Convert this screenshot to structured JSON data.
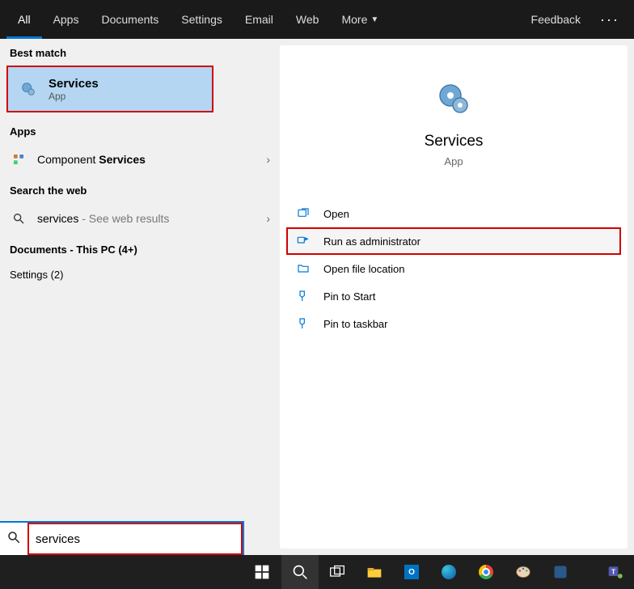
{
  "tabs": {
    "all": "All",
    "apps": "Apps",
    "documents": "Documents",
    "settings": "Settings",
    "email": "Email",
    "web": "Web",
    "more": "More",
    "feedback": "Feedback"
  },
  "left": {
    "best_match_label": "Best match",
    "best_title": "Services",
    "best_sub": "App",
    "apps_label": "Apps",
    "component_prefix": "Component ",
    "component_bold": "Services",
    "search_web_label": "Search the web",
    "web_query": "services",
    "web_suffix": " - See web results",
    "documents_label": "Documents - This PC (4+)",
    "settings_label": "Settings (2)"
  },
  "preview": {
    "title": "Services",
    "sub": "App",
    "actions": {
      "open": "Open",
      "run_admin": "Run as administrator",
      "open_loc": "Open file location",
      "pin_start": "Pin to Start",
      "pin_taskbar": "Pin to taskbar"
    }
  },
  "search": {
    "value": "services"
  },
  "taskbar": {
    "outlook_letter": "O"
  }
}
